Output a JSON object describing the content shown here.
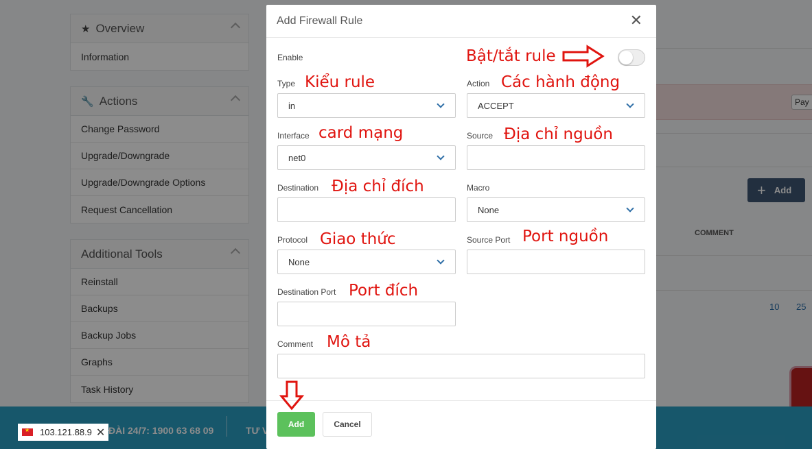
{
  "sidebar": {
    "overview": {
      "title": "Overview",
      "items": [
        "Information"
      ]
    },
    "actions": {
      "title": "Actions",
      "items": [
        "Change Password",
        "Upgrade/Downgrade",
        "Upgrade/Downgrade Options",
        "Request Cancellation"
      ]
    },
    "tools": {
      "title": "Additional Tools",
      "items": [
        "Reinstall",
        "Backups",
        "Backup Jobs",
        "Graphs",
        "Task History"
      ]
    }
  },
  "background": {
    "pay_button": "Pay I",
    "add_button": "Add",
    "comment_header": "COMMENT",
    "pager": [
      "10",
      "25"
    ]
  },
  "footer": {
    "hotline": "ĐÀI 24/7: 1900 63 68 09",
    "second": "TƯ V",
    "ip": "103.121.88.9"
  },
  "modal": {
    "title": "Add Firewall Rule",
    "enable_label": "Enable",
    "enable_value": false,
    "type_label": "Type",
    "type_value": "in",
    "action_label": "Action",
    "action_value": "ACCEPT",
    "interface_label": "Interface",
    "interface_value": "net0",
    "source_label": "Source",
    "source_value": "",
    "destination_label": "Destination",
    "destination_value": "",
    "macro_label": "Macro",
    "macro_value": "None",
    "protocol_label": "Protocol",
    "protocol_value": "None",
    "source_port_label": "Source Port",
    "source_port_value": "",
    "dest_port_label": "Destination Port",
    "dest_port_value": "",
    "comment_label": "Comment",
    "comment_value": "",
    "add_button": "Add",
    "cancel_button": "Cancel"
  },
  "annotations": {
    "enable": "Bật/tắt rule",
    "type": "Kiểu rule",
    "action": "Các hành động",
    "interface": "card mạng",
    "source": "Địa chỉ nguồn",
    "destination": "Địa chỉ đích",
    "protocol": "Giao thức",
    "source_port": "Port nguồn",
    "dest_port": "Port đích",
    "comment": "Mô tả"
  },
  "colors": {
    "annotation": "#e0140f",
    "add_button": "#5cc15c",
    "footer": "#2b9ec3"
  }
}
